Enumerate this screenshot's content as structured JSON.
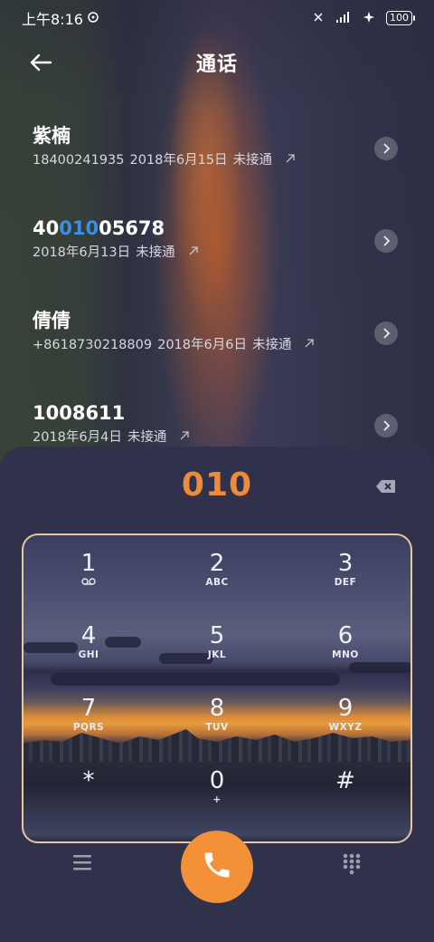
{
  "status_bar": {
    "time": "上午8:16",
    "battery": "100"
  },
  "header": {
    "title": "通话"
  },
  "calls": [
    {
      "name_parts": [
        "紫楠",
        "",
        ""
      ],
      "number": "18400241935",
      "date": "2018年6月15日",
      "status": "未接通"
    },
    {
      "name_parts": [
        "40",
        "010",
        "05678"
      ],
      "number": "",
      "date": "2018年6月13日",
      "status": "未接通"
    },
    {
      "name_parts": [
        "倩倩",
        "",
        ""
      ],
      "number": "+8618730218809",
      "date": "2018年6月6日",
      "status": "未接通"
    },
    {
      "name_parts": [
        "1008611",
        "",
        ""
      ],
      "number": "",
      "date": "2018年6月4日",
      "status": "未接通"
    }
  ],
  "dialer": {
    "entered_number": "010",
    "accent_color": "#f39038",
    "keys": [
      {
        "digit": "1",
        "letters": ""
      },
      {
        "digit": "2",
        "letters": "ABC"
      },
      {
        "digit": "3",
        "letters": "DEF"
      },
      {
        "digit": "4",
        "letters": "GHI"
      },
      {
        "digit": "5",
        "letters": "JKL"
      },
      {
        "digit": "6",
        "letters": "MNO"
      },
      {
        "digit": "7",
        "letters": "PQRS"
      },
      {
        "digit": "8",
        "letters": "TUV"
      },
      {
        "digit": "9",
        "letters": "WXYZ"
      },
      {
        "digit": "*",
        "letters": ""
      },
      {
        "digit": "0",
        "letters": "+"
      },
      {
        "digit": "#",
        "letters": ""
      }
    ]
  },
  "icons": {
    "back": "back-arrow-icon",
    "info": "chevron-right-icon",
    "call_type": "outgoing-call-arrow-icon",
    "backspace": "backspace-icon",
    "menu": "menu-icon",
    "call": "phone-icon",
    "keypad": "dialpad-icon",
    "voicemail": "voicemail-icon"
  }
}
